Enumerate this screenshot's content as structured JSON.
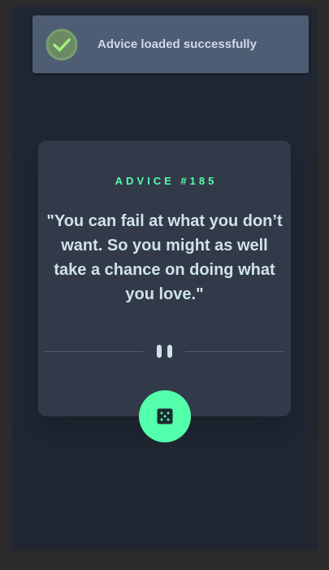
{
  "toast": {
    "message": "Advice loaded successfully",
    "icon": "check-circle-icon"
  },
  "advice": {
    "heading": "ADVICE #185",
    "quote": "\"You can fail at what you don’t want. So you might as well take a chance on doing what you love.\""
  },
  "divider": {
    "icon": "pause-icon"
  },
  "dice_button": {
    "icon": "dice-icon"
  },
  "colors": {
    "background": "#202733",
    "card": "#323a49",
    "accent": "#53ffaa",
    "text": "#cee3e9",
    "divider": "#4f5d74",
    "toast": "#4e5d73"
  }
}
